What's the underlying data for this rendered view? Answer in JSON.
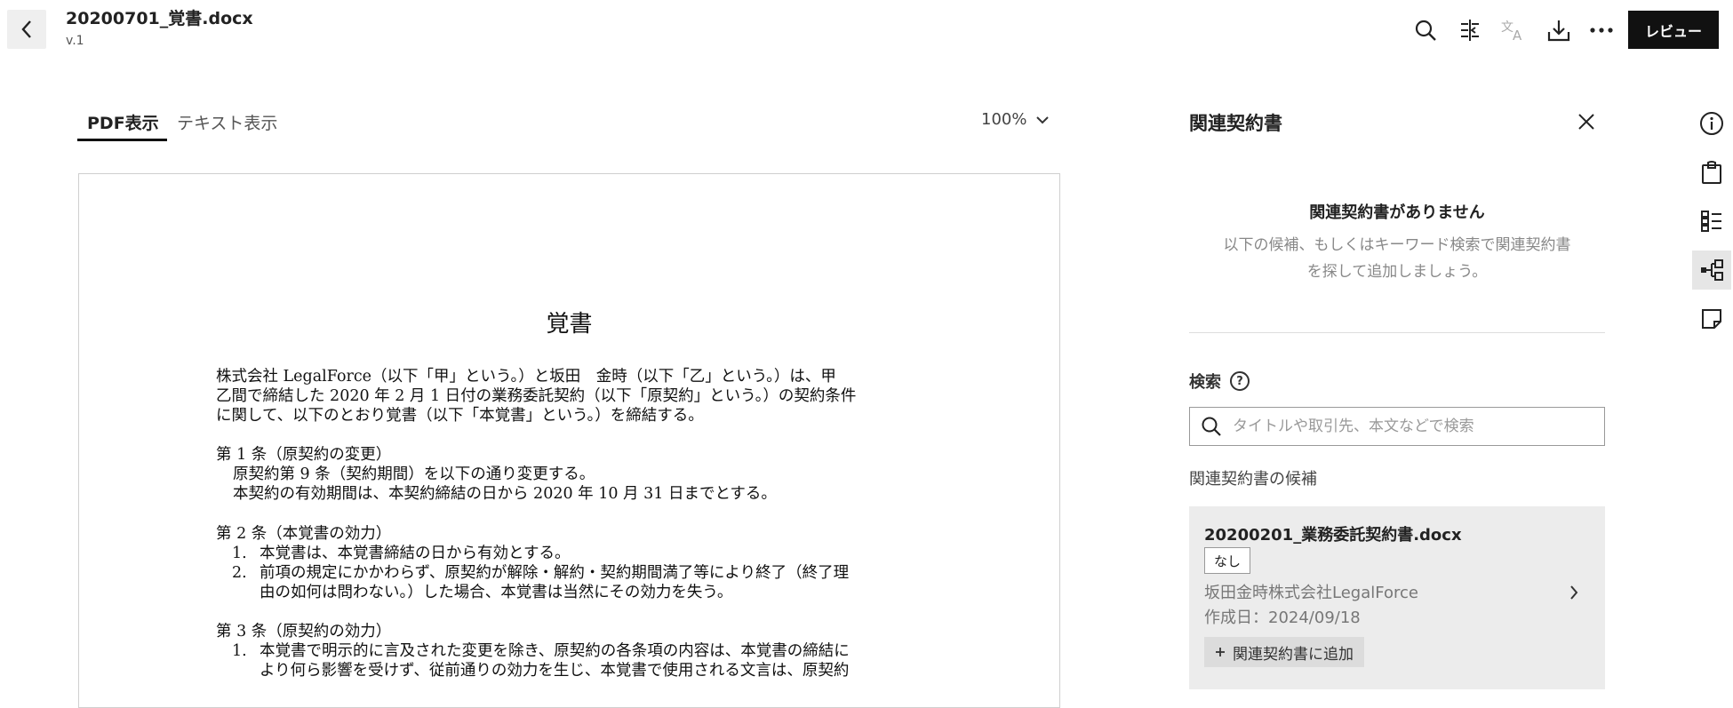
{
  "header": {
    "title": "20200701_覚書.docx",
    "version": "v.1",
    "review_label": "レビュー"
  },
  "viewer": {
    "tabs": [
      {
        "label": "PDF表示",
        "active": true
      },
      {
        "label": "テキスト表示",
        "active": false
      }
    ],
    "zoom": "100%"
  },
  "document": {
    "heading": "覚書",
    "lines": [
      "株式会社 LegalForce（以下「甲」という。）と坂田　金時（以下「乙」という。）は、甲",
      "乙間で締結した 2020 年 2 月 1 日付の業務委託契約（以下「原契約」という。）の契約条件",
      "に関して、以下のとおり覚書（以下「本覚書」という。）を締結する。",
      "第 1 条（原契約の変更）",
      "原契約第 9 条（契約期間）を以下の通り変更する。",
      "本契約の有効期間は、本契約締結の日から 2020 年 10 月 31 日までとする。",
      "第 2 条（本覚書の効力）",
      "1.",
      "本覚書は、本覚書締結の日から有効とする。",
      "2.",
      "前項の規定にかかわらず、原契約が解除・解約・契約期間満了等により終了（終了理",
      "由の如何は問わない。）した場合、本覚書は当然にその効力を失う。",
      "第 3 条（原契約の効力）",
      "1.",
      "本覚書で明示的に言及された変更を除き、原契約の各条項の内容は、本覚書の締結に",
      "より何ら影響を受けず、従前通りの効力を生じ、本覚書で使用される文言は、原契約"
    ]
  },
  "panel": {
    "title": "関連契約書",
    "empty_title": "関連契約書がありません",
    "empty_desc_1": "以下の候補、もしくはキーワード検索で関連契約書",
    "empty_desc_2": "を探して追加しましょう。",
    "search_label": "検索",
    "help_glyph": "?",
    "search_placeholder": "タイトルや取引先、本文などで検索",
    "candidates_label": "関連契約書の候補",
    "candidate": {
      "name": "20200201_業務委託契約書.docx",
      "badge": "なし",
      "party": "坂田金時株式会社LegalForce",
      "created": "作成日：2024/09/18",
      "add_label": "関連契約書に追加"
    }
  },
  "icons": {
    "header": [
      "search-icon",
      "compare-icon",
      "translate-icon",
      "download-icon",
      "more-icon"
    ],
    "sidebar": [
      "info-icon",
      "clipboard-icon",
      "checklist-icon",
      "related-docs-icon",
      "note-icon"
    ]
  }
}
